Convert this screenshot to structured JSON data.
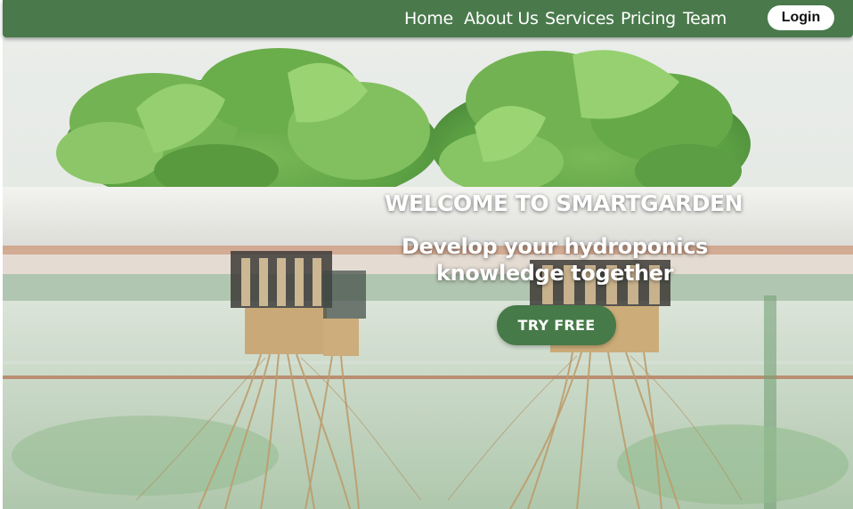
{
  "nav": {
    "links": [
      "Home",
      "About Us",
      "Services",
      "Pricing",
      "Team"
    ],
    "login_label": "Login",
    "background_color": "#4a7a4c"
  },
  "hero": {
    "title": "WELCOME TO SMARTGARDEN",
    "subtitle_line1": "Develop your hydroponics",
    "subtitle_line2": "knowledge together",
    "cta_label": "TRY FREE",
    "cta_color": "#467a48",
    "image": "hydroponic-lettuce-roots"
  }
}
